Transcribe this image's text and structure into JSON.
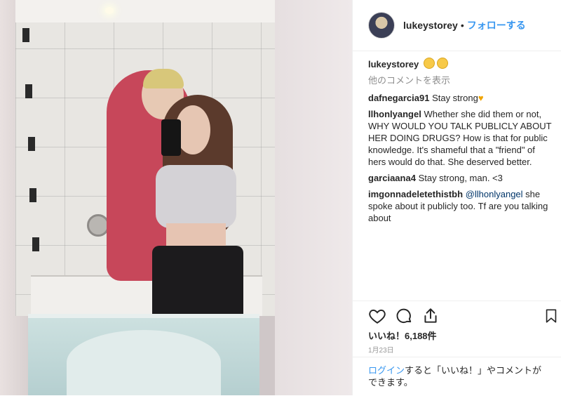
{
  "post": {
    "username": "lukeystorey",
    "separator": "•",
    "follow_label": "フォローする"
  },
  "caption": {
    "username": "lukeystorey"
  },
  "view_more_comments": "他のコメントを表示",
  "comments": [
    {
      "user": "dafnegarcia91",
      "text": "Stay strong"
    },
    {
      "user": "llhonlyangel",
      "text": "Whether she did them or not, WHY WOULD YOU TALK PUBLICLY ABOUT HER DOING DRUGS? How is that for public knowledge. It's shameful that a \"friend\" of hers would do that. She deserved better."
    },
    {
      "user": "garciaana4",
      "text": "Stay strong, man. <3"
    },
    {
      "user": "imgonnadeletethistbh",
      "mention": "@llhonlyangel",
      "text": "she spoke about it publicly too. Tf are you talking about"
    }
  ],
  "likes": "いいね！6,188件",
  "date": "1月23日",
  "login_prompt": {
    "link": "ログイン",
    "text": "すると「いいね！」やコメントができます。"
  },
  "icons": [
    "heart-icon",
    "comment-icon",
    "share-icon",
    "bookmark-icon",
    "smile-emoji-icon",
    "yellow-heart-icon"
  ],
  "colors": {
    "link": "#3897f0",
    "text": "#262626",
    "muted": "#8e8e8e"
  }
}
